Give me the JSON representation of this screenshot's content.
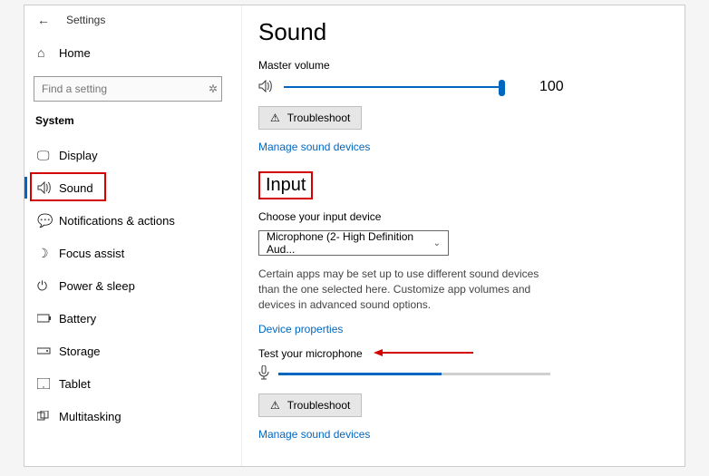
{
  "topbar": {
    "title": "Settings"
  },
  "home": {
    "label": "Home"
  },
  "search": {
    "placeholder": "Find a setting"
  },
  "system": {
    "heading": "System"
  },
  "nav": {
    "display": "Display",
    "sound": "Sound",
    "notifications": "Notifications & actions",
    "focus": "Focus assist",
    "power": "Power & sleep",
    "battery": "Battery",
    "storage": "Storage",
    "tablet": "Tablet",
    "multitasking": "Multitasking"
  },
  "page": {
    "title": "Sound",
    "master_volume_label": "Master volume",
    "volume_value": "100",
    "troubleshoot": "Troubleshoot",
    "manage_sound_devices": "Manage sound devices",
    "input_heading": "Input",
    "choose_input_label": "Choose your input device",
    "input_device": "Microphone (2- High Definition Aud...",
    "input_desc": "Certain apps may be set up to use different sound devices than the one selected here. Customize app volumes and devices in advanced sound options.",
    "device_properties": "Device properties",
    "test_mic_label": "Test your microphone",
    "troubleshoot2": "Troubleshoot",
    "manage_sound_devices2": "Manage sound devices"
  }
}
